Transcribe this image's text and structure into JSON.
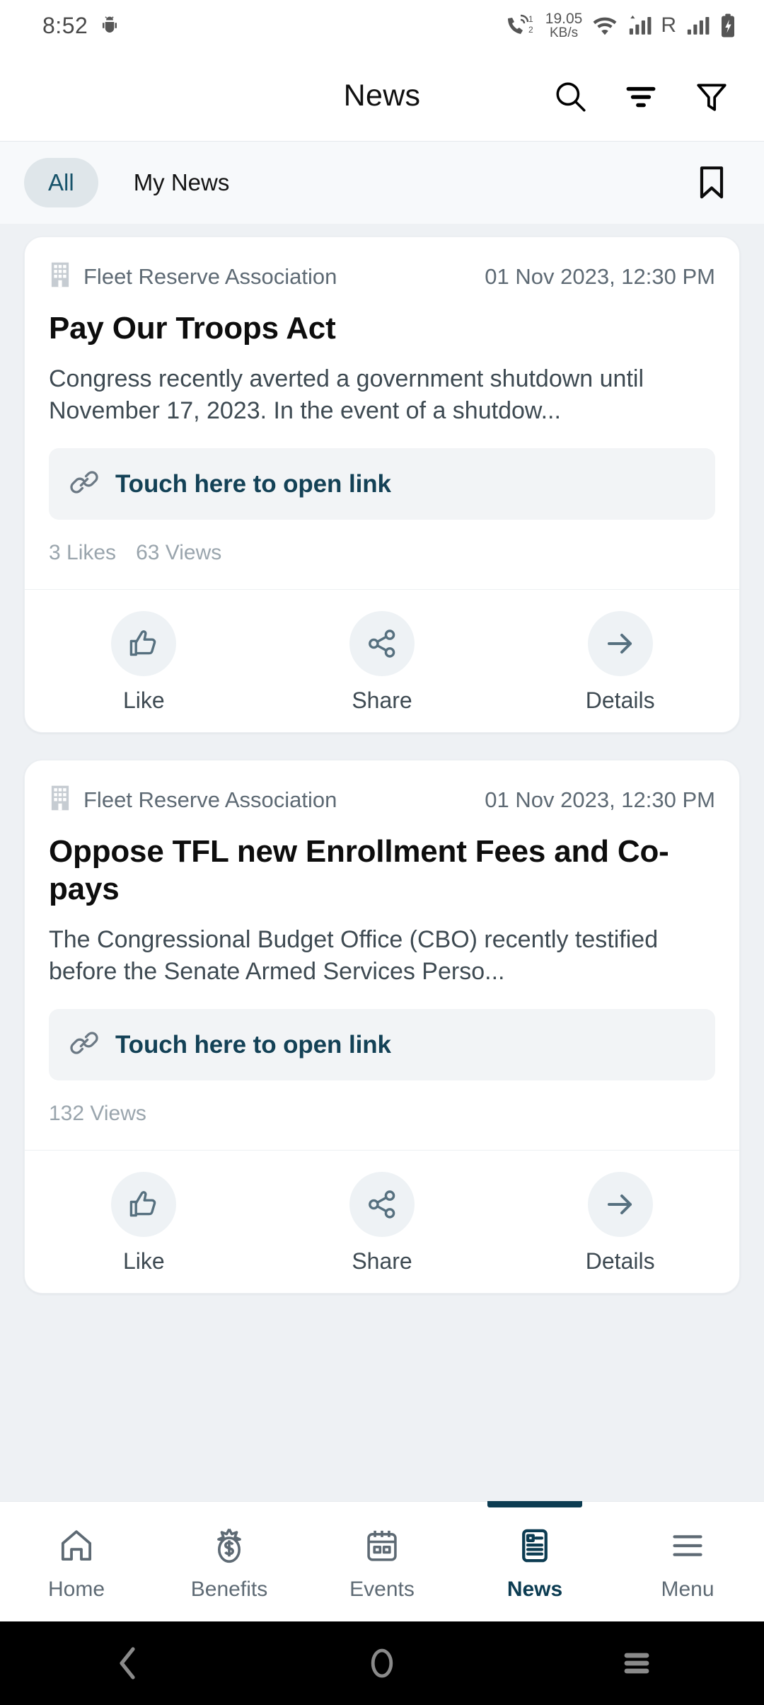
{
  "status_bar": {
    "time": "8:52",
    "net_speed_value": "19.05",
    "net_speed_unit": "KB/s",
    "sim1": "1",
    "sim2": "2",
    "roaming": "R"
  },
  "header": {
    "title": "News",
    "actions": [
      {
        "name": "search-icon",
        "label": "Search"
      },
      {
        "name": "sort-icon",
        "label": "Sort"
      },
      {
        "name": "filter-icon",
        "label": "Filter"
      }
    ]
  },
  "tabs": {
    "items": [
      {
        "label": "All",
        "active": true
      },
      {
        "label": "My News",
        "active": false
      }
    ],
    "bookmark_label": "Bookmarks"
  },
  "feed": {
    "cards": [
      {
        "source": "Fleet Reserve Association",
        "date": "01 Nov 2023, 12:30 PM",
        "title": "Pay Our Troops Act",
        "body": "Congress recently averted a government shutdown until November 17, 2023. In the event of a shutdow...",
        "link_label": "Touch here to open link",
        "likes": "3 Likes",
        "views": "63 Views",
        "actions": [
          {
            "label": "Like",
            "icon": "thumbs-up-icon"
          },
          {
            "label": "Share",
            "icon": "share-icon"
          },
          {
            "label": "Details",
            "icon": "arrow-right-icon"
          }
        ]
      },
      {
        "source": "Fleet Reserve Association",
        "date": "01 Nov 2023, 12:30 PM",
        "title": "Oppose TFL new Enrollment Fees and Co-pays",
        "body": "The Congressional Budget Office (CBO) recently testified before the Senate Armed Services Perso...",
        "link_label": "Touch here to open link",
        "likes": "",
        "views": "132 Views",
        "actions": [
          {
            "label": "Like",
            "icon": "thumbs-up-icon"
          },
          {
            "label": "Share",
            "icon": "share-icon"
          },
          {
            "label": "Details",
            "icon": "arrow-right-icon"
          }
        ]
      }
    ]
  },
  "bottom_nav": {
    "items": [
      {
        "label": "Home",
        "icon": "home-icon",
        "active": false
      },
      {
        "label": "Benefits",
        "icon": "money-bag-icon",
        "active": false
      },
      {
        "label": "Events",
        "icon": "calendar-icon",
        "active": false
      },
      {
        "label": "News",
        "icon": "news-article-icon",
        "active": true
      },
      {
        "label": "Menu",
        "icon": "hamburger-menu-icon",
        "active": false
      }
    ]
  },
  "system_nav": {
    "back": "Back",
    "home": "Home",
    "recents": "Recents"
  },
  "colors": {
    "accent": "#0c3c52",
    "link": "#134156",
    "page_bg": "#eef1f4",
    "card_bg": "#ffffff",
    "muted_text": "#5e6a74"
  }
}
